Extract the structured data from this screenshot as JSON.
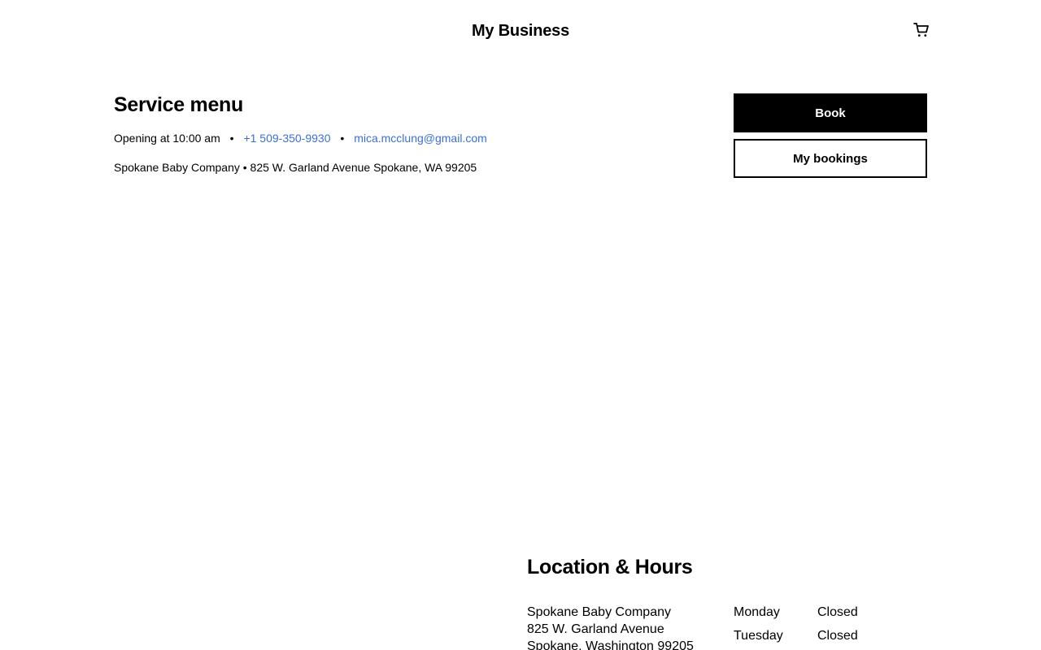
{
  "header": {
    "site_title": "My Business",
    "cart_icon": "shopping-cart-icon"
  },
  "service": {
    "title": "Service menu",
    "opening": "Opening at 10:00 am",
    "separator": "•",
    "phone": "+1 509-350-9930",
    "email": "mica.mcclung@gmail.com",
    "address": "Spokane Baby Company • 825 W. Garland Avenue Spokane, WA 99205",
    "link_color": "#3b6fd8"
  },
  "actions": {
    "book_label": "Book",
    "bookings_label": "My bookings"
  },
  "location": {
    "title": "Location & Hours",
    "address_lines": [
      "Spokane Baby Company",
      "825 W. Garland Avenue",
      "Spokane, Washington 99205"
    ],
    "hours": [
      {
        "day": "Monday",
        "status": "Closed"
      },
      {
        "day": "Tuesday",
        "status": "Closed"
      }
    ]
  }
}
